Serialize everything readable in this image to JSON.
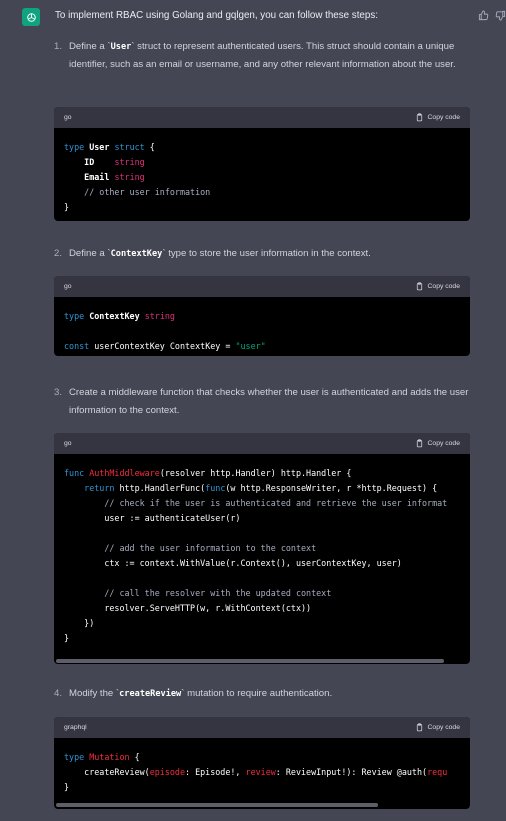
{
  "intro": "To implement RBAC using Golang and gqlgen, you can follow these steps:",
  "copy_label": "Copy code",
  "steps": [
    {
      "num": "1.",
      "text_before": "Define a `",
      "code": "User",
      "text_after": "` struct to represent authenticated users. This struct should contain a unique identifier, such as an email or username, and any other relevant information about the user."
    },
    {
      "num": "2.",
      "text_before": "Define a `",
      "code": "ContextKey",
      "text_after": "` type to store the user information in the context."
    },
    {
      "num": "3.",
      "text_before": "Create a middleware function that checks whether the user is authenticated and adds the user information to the context.",
      "code": "",
      "text_after": ""
    },
    {
      "num": "4.",
      "text_before": "Modify the `",
      "code": "createReview",
      "text_after": "` mutation to require authentication."
    }
  ],
  "code_blocks": [
    {
      "language": "go",
      "lines": [
        "type User struct {",
        "    ID    string",
        "    Email string",
        "    // other user information",
        "}"
      ]
    },
    {
      "language": "go",
      "lines": [
        "type ContextKey string",
        "",
        "const userContextKey ContextKey = \"user\""
      ]
    },
    {
      "language": "go",
      "lines": [
        "func AuthMiddleware(resolver http.Handler) http.Handler {",
        "    return http.HandlerFunc(func(w http.ResponseWriter, r *http.Request) {",
        "        // check if the user is authenticated and retrieve the user informat",
        "        user := authenticateUser(r)",
        "",
        "        // add the user information to the context",
        "        ctx := context.WithValue(r.Context(), userContextKey, user)",
        "",
        "        // call the resolver with the updated context",
        "        resolver.ServeHTTP(w, r.WithContext(ctx))",
        "    })",
        "}"
      ]
    },
    {
      "language": "graphql",
      "lines": [
        "type Mutation {",
        "    createReview(episode: Episode!, review: ReviewInput!): Review @auth(requ",
        "}"
      ]
    }
  ],
  "colors": {
    "background": "#444654",
    "code_bg": "#000000",
    "code_header": "#343541",
    "keyword": "#2e95d3",
    "type": "#df3079",
    "string": "#00a67d",
    "function": "#f22c3d",
    "comment": "#a9aec1",
    "avatar": "#10a37f"
  }
}
